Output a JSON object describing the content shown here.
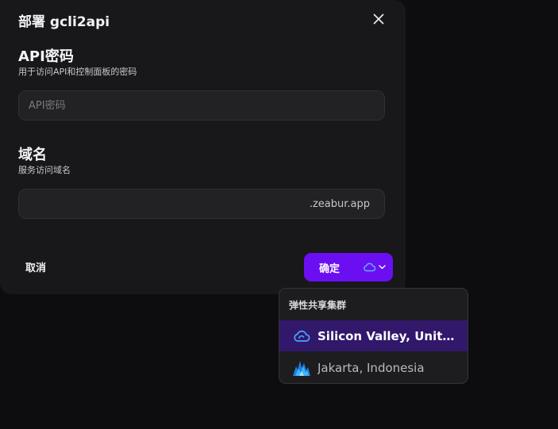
{
  "modal": {
    "title": "部署 gcli2api"
  },
  "api_password": {
    "title": "API密码",
    "description": "用于访问API和控制面板的密码",
    "placeholder": "API密码",
    "value": ""
  },
  "domain": {
    "title": "域名",
    "description": "服务访问域名",
    "value": "",
    "suffix": ".zeabur.app"
  },
  "footer": {
    "cancel_label": "取消",
    "confirm_label": "确定"
  },
  "region_dropdown": {
    "header": "弹性共享集群",
    "items": [
      {
        "label": "Silicon Valley, United States",
        "icon": "cloud-icon",
        "selected": true
      },
      {
        "label": "Jakarta, Indonesia",
        "icon": "mountain-icon",
        "selected": false
      }
    ]
  },
  "colors": {
    "accent": "#6b0ff2",
    "selected_row": "#31186b",
    "cloud_icon": "#4aa3ff"
  }
}
